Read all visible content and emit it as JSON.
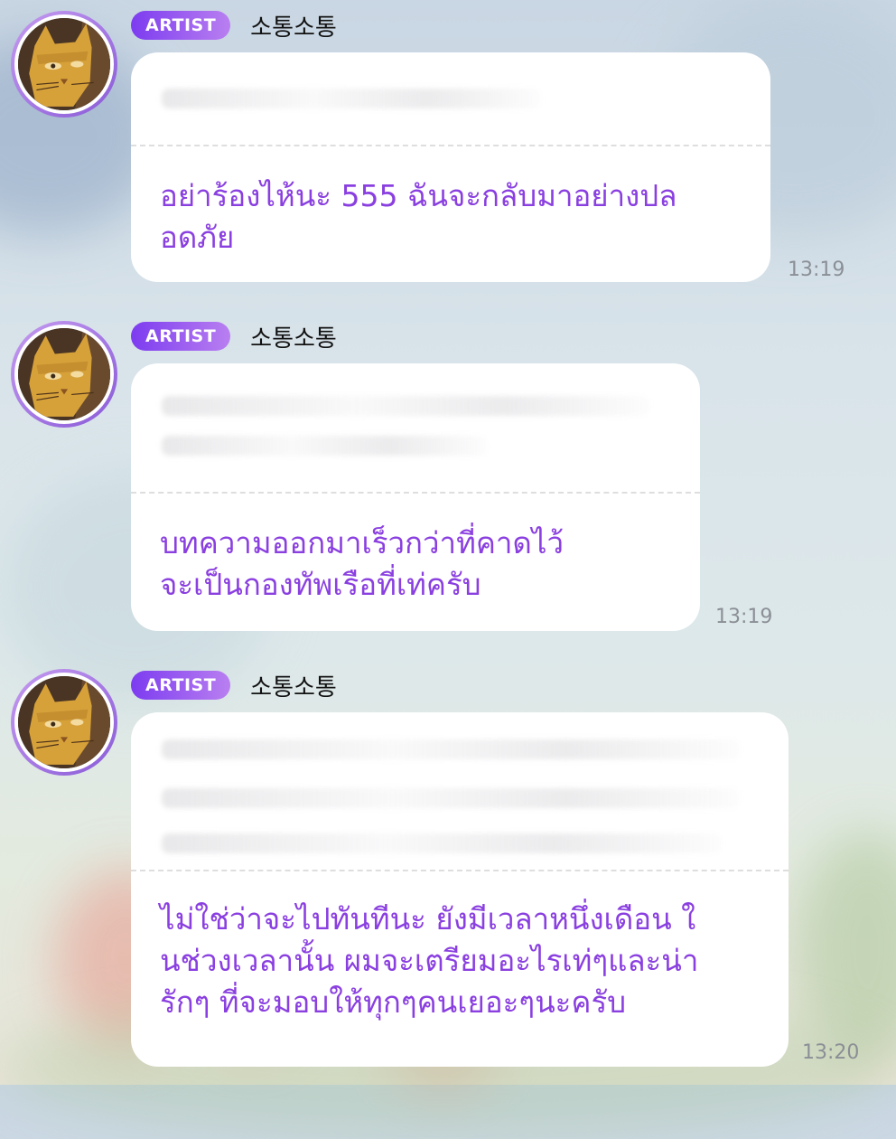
{
  "messages": [
    {
      "badge": "ARTIST",
      "name": "소통소통",
      "original": "을 ... 는게",
      "translation": "อย่าร้องไห้นะ 555 ฉันจะกลับมาอย่างปล\nอดภัย",
      "time": "13:19"
    },
    {
      "badge": "ARTIST",
      "name": "소통소통",
      "original": "",
      "translation": "บทความออกมาเร็วกว่าที่คาดไว้\nจะเป็นกองทัพเรือที่เท่ครับ",
      "time": "13:19"
    },
    {
      "badge": "ARTIST",
      "name": "소통소통",
      "original": "... 할 것들을 ... 요",
      "translation": "ไม่ใช่ว่าจะไปทันทีนะ ยังมีเวลาหนึ่งเดือน ใ\nนช่วงเวลานั้น ผมจะเตรียมอะไรเท่ๆและน่า\nรักๆ ที่จะมอบให้ทุกๆคนเยอะๆนะครับ",
      "time": "13:20"
    }
  ],
  "colors": {
    "badge_gradient_start": "#7c3cf0",
    "badge_gradient_end": "#b97ff0",
    "translation_text": "#8a3fe0",
    "bubble": "#ffffff",
    "timestamp": "#8b8f96"
  },
  "icons": {
    "avatar": "cat-portrait-avatar"
  }
}
